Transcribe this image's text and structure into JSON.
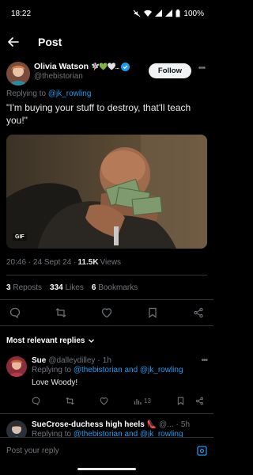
{
  "status": {
    "time": "18:22",
    "battery": "100%"
  },
  "nav": {
    "title": "Post"
  },
  "tweet": {
    "display_name": "Olivia Watson",
    "emojis": "🧚🏻‍♀️💚🤍...",
    "handle": "@thebistorian",
    "follow_label": "Follow",
    "replying_prefix": "Replying to",
    "replying_handle": "@jk_rowling",
    "text": "\"I'm buying your stuff to destroy, that'll teach you!\"",
    "media_badge": "GIF",
    "timestamp": "20:46 · 24 Sept 24 · ",
    "views_count": "11.5K",
    "views_label": " Views",
    "stats": {
      "reposts_num": "3",
      "reposts_label": "Reposts",
      "likes_num": "334",
      "likes_label": "Likes",
      "bookmarks_num": "6",
      "bookmarks_label": "Bookmarks"
    }
  },
  "replies_sort": {
    "label": "Most relevant replies"
  },
  "replies": [
    {
      "name": "Sue",
      "handle": "@dalleydilley",
      "sep": "·",
      "time": "1h",
      "replying_prefix": "Replying to",
      "replying_to": "@thebistorian and @jk_rowling",
      "text": "Love Woody!",
      "views": "13"
    },
    {
      "name": "SueCrose-duchess high heels 👠",
      "handle": "@...",
      "sep": "·",
      "time": "5h",
      "replying_prefix": "Replying to",
      "replying_to": "@thebistorian and @jk_rowling"
    }
  ],
  "compose": {
    "placeholder": "Post your reply"
  },
  "colors": {
    "accent": "#1d9bf0",
    "background": "#000000",
    "muted": "#71767b"
  }
}
